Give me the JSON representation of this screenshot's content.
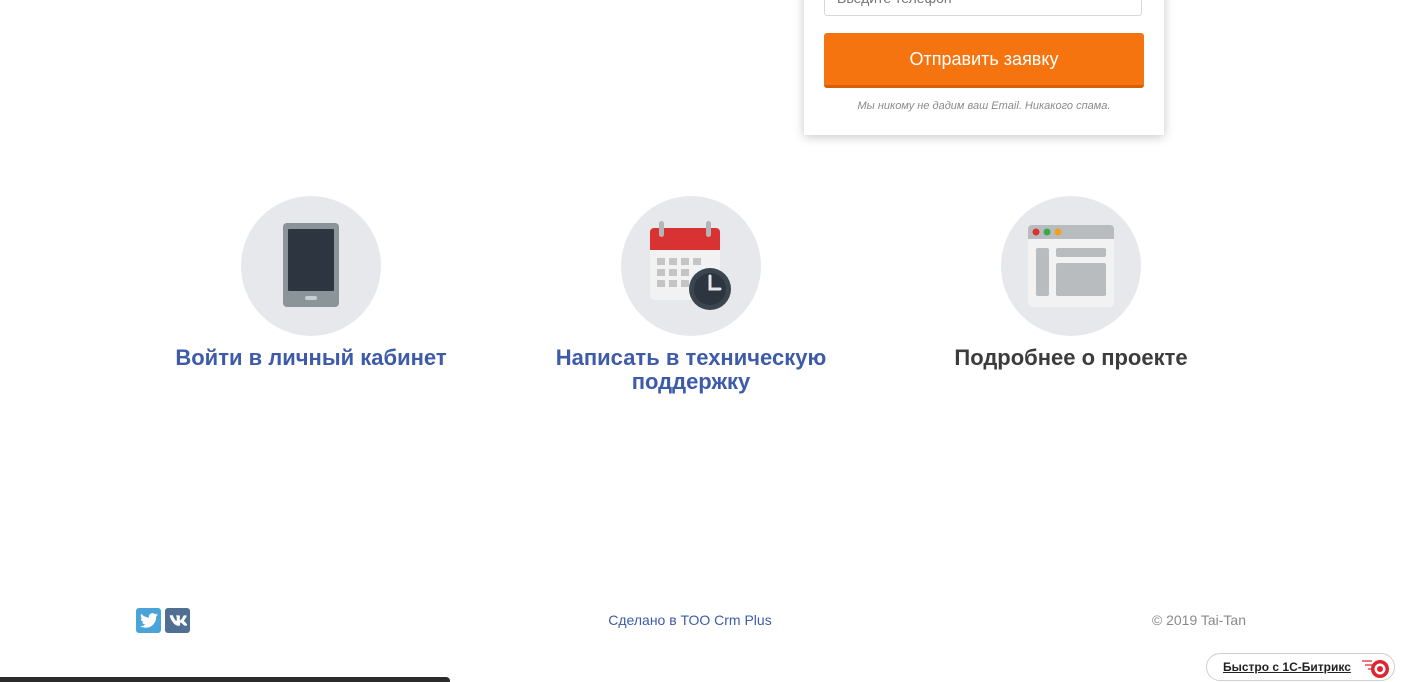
{
  "form": {
    "input_placeholder": "Введите телефон",
    "submit_label": "Отправить заявку",
    "privacy_note": "Мы никому не дадим ваш Email. Никакого спама."
  },
  "features": [
    {
      "title": "Войти в личный кабинет",
      "icon": "tablet-icon"
    },
    {
      "title": "Написать в техническую поддержку",
      "icon": "calendar-clock-icon"
    },
    {
      "title": "Подробнее о проекте",
      "icon": "browser-window-icon"
    }
  ],
  "footer": {
    "social": [
      "twitter-icon",
      "vk-icon"
    ],
    "made_by": "Сделано в ТОО Crm Plus",
    "copyright": "© 2019 Tai-Tan"
  },
  "badge": {
    "label": "Быстро с 1С-Битрикс"
  },
  "colors": {
    "accent_orange": "#f5740f",
    "link_blue": "#3d5ba9",
    "icon_circle": "#e6e8eb"
  }
}
